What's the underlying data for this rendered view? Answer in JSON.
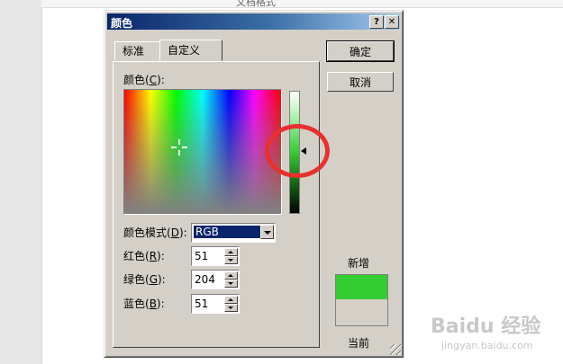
{
  "background": {
    "document_title": "文档格式"
  },
  "dialog": {
    "title": "颜色",
    "help_glyph": "?",
    "close_glyph": "✕",
    "tabs": [
      {
        "label": "标准",
        "selected": false
      },
      {
        "label": "自定义",
        "selected": true
      }
    ],
    "color_label": "颜色(C):",
    "color_label_prefix": "颜色(",
    "color_label_key": "C",
    "color_label_suffix": "):",
    "color_model_prefix": "颜色模式(",
    "color_model_key": "D",
    "color_model_suffix": "):",
    "color_model_value": "RGB",
    "red_prefix": "红色(",
    "red_key": "R",
    "red_suffix": "):",
    "red_value": "51",
    "green_prefix": "绿色(",
    "green_key": "G",
    "green_suffix": "):",
    "green_value": "204",
    "blue_prefix": "蓝色(",
    "blue_key": "B",
    "blue_suffix": "):",
    "blue_value": "51",
    "ok_label": "确定",
    "cancel_label": "取消",
    "new_label": "新增",
    "current_label": "当前",
    "colors": {
      "new": "#33cc33",
      "current": "#d4d0c8",
      "highlight_circle": "#e8312f"
    }
  },
  "watermark": {
    "brand": "Baidu 经验",
    "url": "jingyan.baidu.com"
  }
}
